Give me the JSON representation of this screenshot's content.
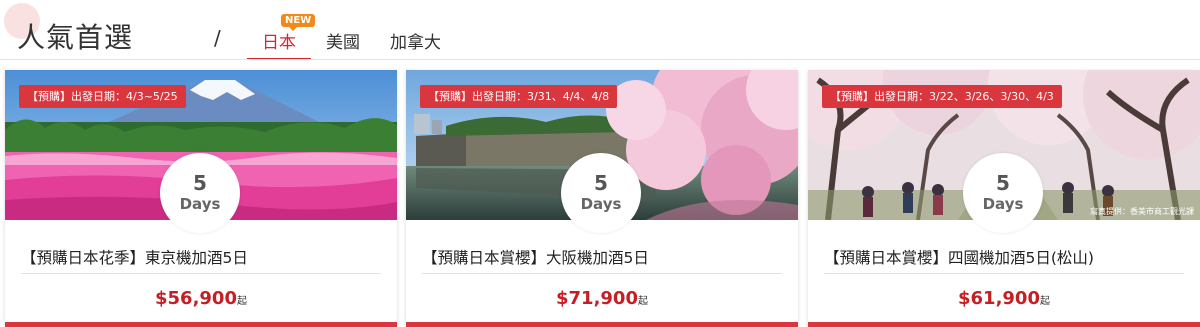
{
  "header": {
    "title": "人氣首選",
    "separator": "/",
    "tabs": [
      {
        "label": "日本",
        "active": true,
        "badge": "NEW"
      },
      {
        "label": "美國",
        "active": false
      },
      {
        "label": "加拿大",
        "active": false
      }
    ]
  },
  "colors": {
    "accent": "#d6262f",
    "badge": "#f28a1a",
    "price": "#c41f25"
  },
  "cards": [
    {
      "date_tag": "【預購】出發日期：4/3~5/25",
      "days_number": "5",
      "days_unit": "Days",
      "title": "【預購日本花季】東京機加酒5日",
      "price": "$56,900",
      "price_suffix": "起",
      "image": "mount-fuji-pink-moss-photo"
    },
    {
      "date_tag": "【預購】出發日期：3/31、4/4、4/8",
      "days_number": "5",
      "days_unit": "Days",
      "title": "【預購日本賞櫻】大阪機加酒5日",
      "price": "$71,900",
      "price_suffix": "起",
      "image": "osaka-castle-moat-cherry-blossom-photo"
    },
    {
      "date_tag": "【預購】出發日期：3/22、3/26、3/30、4/3",
      "days_number": "5",
      "days_unit": "Days",
      "title": "【預購日本賞櫻】四國機加酒5日(松山)",
      "price": "$61,900",
      "price_suffix": "起",
      "image": "cherry-blossom-avenue-photo",
      "photo_credit": "寫真提供：香美市商工觀光課"
    }
  ]
}
